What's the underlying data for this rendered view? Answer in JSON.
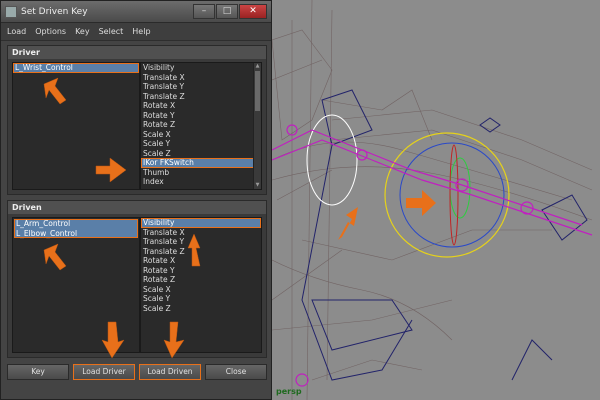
{
  "window": {
    "title": "Set Driven Key",
    "minimize": "–",
    "maximize": "□",
    "close": "✕"
  },
  "menu": [
    "Load",
    "Options",
    "Key",
    "Select",
    "Help"
  ],
  "driver": {
    "header": "Driver",
    "objects": [
      {
        "label": "L_Wrist_Control",
        "selected": true
      }
    ],
    "attributes": [
      {
        "label": "Visibility"
      },
      {
        "label": "Translate X"
      },
      {
        "label": "Translate Y"
      },
      {
        "label": "Translate Z"
      },
      {
        "label": "Rotate X"
      },
      {
        "label": "Rotate Y"
      },
      {
        "label": "Rotate Z"
      },
      {
        "label": "Scale X"
      },
      {
        "label": "Scale Y"
      },
      {
        "label": "Scale Z"
      },
      {
        "label": "IKor FKSwitch",
        "selected": true
      },
      {
        "label": "Thumb"
      },
      {
        "label": "Index"
      }
    ]
  },
  "driven": {
    "header": "Driven",
    "objects": [
      {
        "label": "L_Arm_Control",
        "selected": true
      },
      {
        "label": "L_Elbow_Control",
        "selected": true
      }
    ],
    "attributes": [
      {
        "label": "Visibility",
        "selected": true
      },
      {
        "label": "Translate X"
      },
      {
        "label": "Translate Y"
      },
      {
        "label": "Translate Z"
      },
      {
        "label": "Rotate X"
      },
      {
        "label": "Rotate Y"
      },
      {
        "label": "Rotate Z"
      },
      {
        "label": "Scale X"
      },
      {
        "label": "Scale Y"
      },
      {
        "label": "Scale Z"
      }
    ]
  },
  "buttons": {
    "key": "Key",
    "load_driver": "Load Driver",
    "load_driven": "Load Driven",
    "close": "Close"
  },
  "viewport": {
    "camera_label": "persp"
  },
  "colors": {
    "highlight": "#e8701a",
    "selection": "#5a7fa8",
    "panel": "#444444"
  }
}
